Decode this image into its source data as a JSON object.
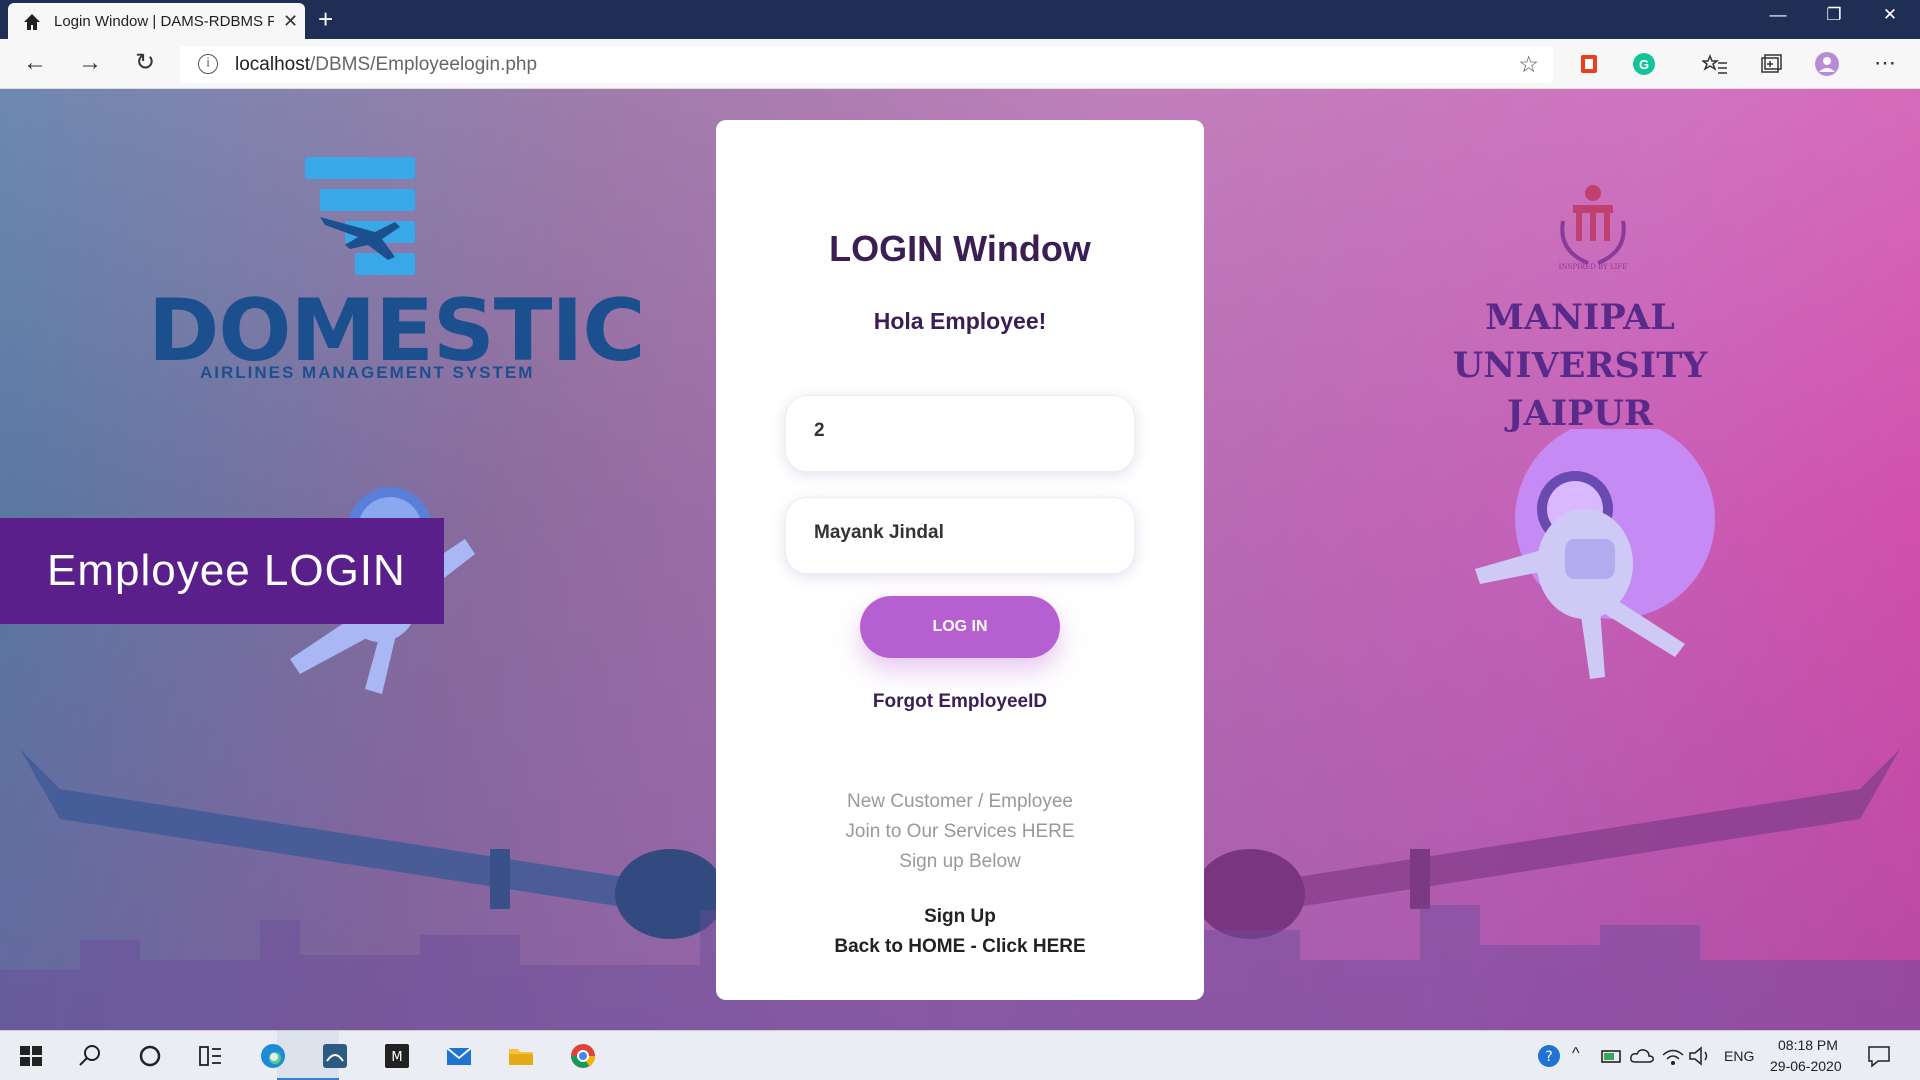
{
  "browser": {
    "tab_title": "Login Window | DAMS-RDBMS P",
    "url_host": "localhost",
    "url_path": "/DBMS/Employeelogin.php"
  },
  "page": {
    "brand_name": "DOMESTIC",
    "brand_tagline": "AIRLINES MANAGEMENT SYSTEM",
    "banner_label": "Employee LOGIN",
    "university_line1": "MANIPAL UNIVERSITY",
    "university_line2": "JAIPUR",
    "seal_motto": "INSPIRED BY LIFE"
  },
  "login": {
    "title": "LOGIN Window",
    "greeting": "Hola Employee!",
    "id_value": "2",
    "name_value": "Mayank Jindal",
    "button_label": "LOG IN",
    "forgot_link": "Forgot EmployeeID",
    "info_line1": "New Customer / Employee",
    "info_line2": "Join to Our Services HERE",
    "info_line3": "Sign up Below",
    "signup_link": "Sign Up",
    "home_link": "Back to HOME - Click HERE"
  },
  "taskbar": {
    "language": "ENG",
    "time": "08:18 PM",
    "date": "29-06-2020"
  }
}
